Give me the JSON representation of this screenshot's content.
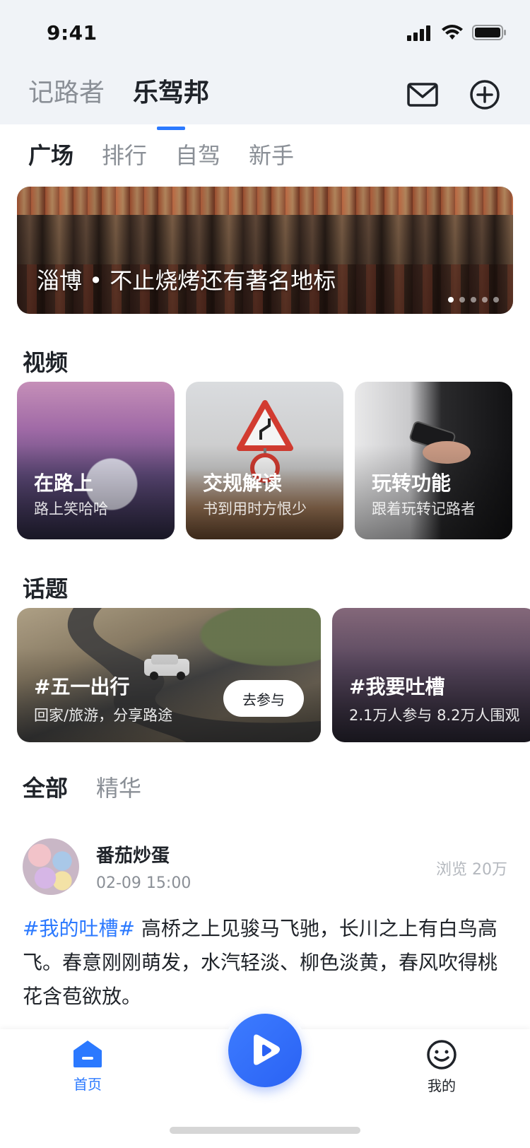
{
  "status_bar": {
    "time": "9:41"
  },
  "header": {
    "tabs": [
      {
        "label": "记路者",
        "active": false
      },
      {
        "label": "乐驾邦",
        "active": true
      }
    ],
    "icons": [
      "mail-icon",
      "add-circle-icon"
    ]
  },
  "sub_tabs": [
    {
      "label": "广场",
      "active": true
    },
    {
      "label": "排行",
      "active": false
    },
    {
      "label": "自驾",
      "active": false
    },
    {
      "label": "新手",
      "active": false
    }
  ],
  "banner": {
    "title": "淄博 • 不止烧烤还有著名地标",
    "dot_count": 5,
    "active_dot": 0
  },
  "videos": {
    "section_title": "视频",
    "items": [
      {
        "title": "在路上",
        "subtitle": "路上笑哈哈"
      },
      {
        "title": "交规解读",
        "subtitle": "书到用时方恨少"
      },
      {
        "title": "玩转功能",
        "subtitle": "跟着玩转记路者"
      }
    ]
  },
  "topics": {
    "section_title": "话题",
    "items": [
      {
        "title": "#五一出行",
        "subtitle": "回家/旅游，分享路途",
        "button": "去参与"
      },
      {
        "title": "#我要吐槽",
        "subtitle": "2.1万人参与 8.2万人围观"
      }
    ]
  },
  "feed": {
    "tabs": [
      {
        "label": "全部",
        "active": true
      },
      {
        "label": "精华",
        "active": false
      }
    ],
    "post": {
      "author": "番茄炒蛋",
      "time": "02-09 15:00",
      "views": "浏览 20万",
      "tag": "#我的吐槽#",
      "body": " 高桥之上见骏马飞驰，长川之上有白鸟高飞。春意刚刚萌发，水汽轻淡、柳色淡黄，春风吹得桃花含苞欲放。"
    }
  },
  "tab_bar": {
    "home_label": "首页",
    "mine_label": "我的",
    "accent": "#2b79ff"
  },
  "colors": {
    "accent": "#2b79ff",
    "header_bg": "#f0f3f7",
    "text_primary": "#1f2329",
    "text_secondary": "#8a8f96"
  }
}
